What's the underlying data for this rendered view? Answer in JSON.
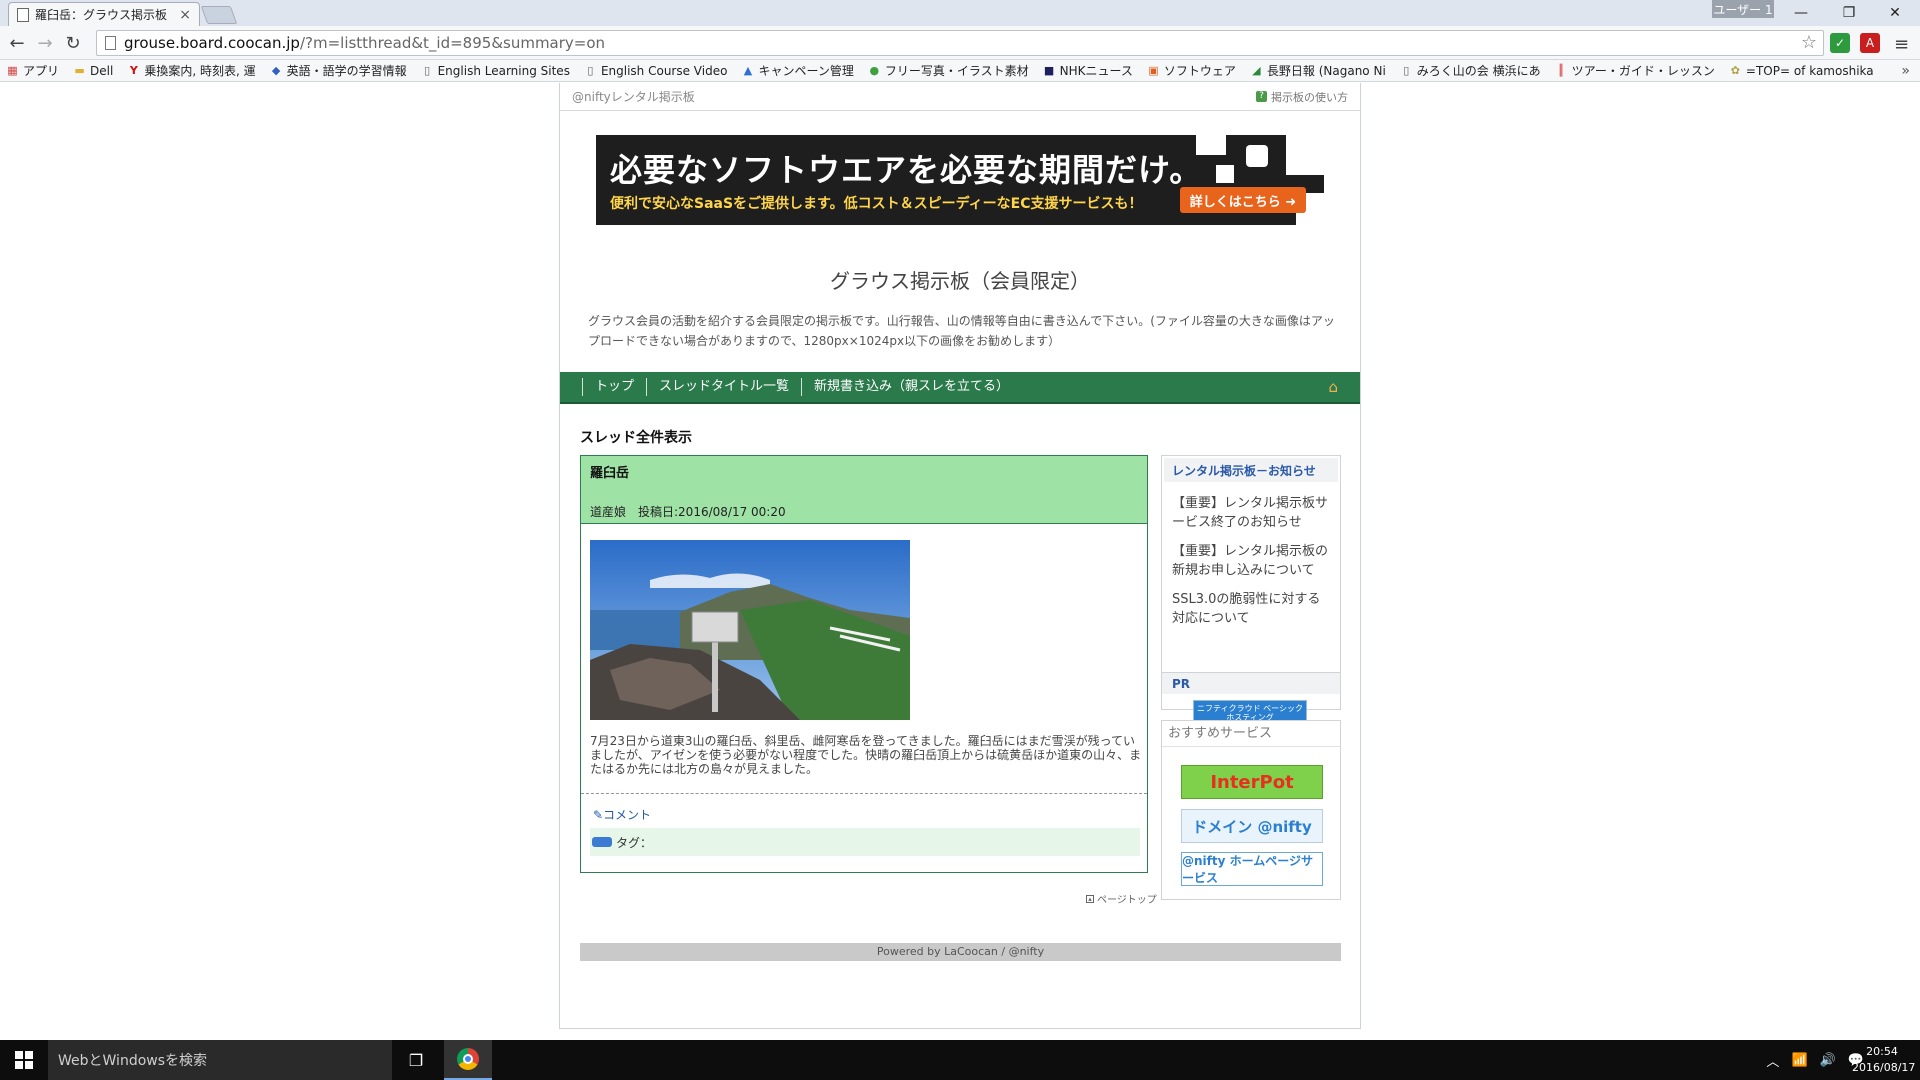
{
  "browser": {
    "tab_title": "羅臼岳：グラウス掲示板（会",
    "tab_close": "×",
    "user_badge": "ユーザー 1",
    "minimize": "—",
    "restore": "❐",
    "close": "✕",
    "back": "←",
    "forward": "→",
    "reload": "↻",
    "url_host": "grouse.board.coocan.jp",
    "url_rest": "/?m=listthread&t_id=895&summary=on",
    "star": "☆",
    "menu": "≡"
  },
  "bookmarks": [
    {
      "label": "アプリ",
      "icon": "apps-icon",
      "glyph": "▦",
      "color": "#d04040"
    },
    {
      "label": "Dell",
      "icon": "folder-icon",
      "glyph": "▬",
      "color": "#e0b030"
    },
    {
      "label": "乗換案内, 時刻表, 運",
      "icon": "yahoo-icon",
      "glyph": "Y",
      "color": "#d01010"
    },
    {
      "label": "英語・語学の学習情報",
      "icon": "link-icon",
      "glyph": "◆",
      "color": "#3060c0"
    },
    {
      "label": "English Learning Sites",
      "icon": "page-icon",
      "glyph": "▯",
      "color": "#666666"
    },
    {
      "label": "English Course Video",
      "icon": "page-icon",
      "glyph": "▯",
      "color": "#666666"
    },
    {
      "label": "キャンペーン管理",
      "icon": "adwords-icon",
      "glyph": "▲",
      "color": "#3070d0"
    },
    {
      "label": "フリー写真・イラスト素材",
      "icon": "globe-icon",
      "glyph": "●",
      "color": "#40a040"
    },
    {
      "label": "NHKニュース",
      "icon": "nhk-icon",
      "glyph": "■",
      "color": "#202060"
    },
    {
      "label": "ソフトウェア",
      "icon": "windows-icon",
      "glyph": "▣",
      "color": "#e06020"
    },
    {
      "label": "長野日報 (Nagano Ni",
      "icon": "nagano-icon",
      "glyph": "◢",
      "color": "#2a8a3a"
    },
    {
      "label": "みろく山の会 横浜にあ",
      "icon": "page-icon",
      "glyph": "▯",
      "color": "#666666"
    },
    {
      "label": "ツアー・ガイド・レッスン",
      "icon": "tour-icon",
      "glyph": "║",
      "color": "#d02020"
    },
    {
      "label": "=TOP= of kamoshika",
      "icon": "kamoshika-icon",
      "glyph": "✿",
      "color": "#b0a040"
    }
  ],
  "bookmarks_more": "»",
  "page": {
    "header_label": "@niftyレンタル掲示板",
    "help_link": "掲示板の使い方",
    "help_glyph": "?",
    "banner": {
      "headline": "必要なソフトウエアを必要な期間だけ。",
      "subline": "便利で安心なSaaSをご提供します。低コスト＆スピーディーなEC支援サービスも！",
      "button": "詳しくはこちら ➜"
    },
    "board_title": "グラウス掲示板（会員限定）",
    "board_description": "グラウス会員の活動を紹介する会員限定の掲示板です。山行報告、山の情報等自由に書き込んで下さい。(ファイル容量の大きな画像はアップロードできない場合がありますので、1280px×1024px以下の画像をお勧めします）",
    "nav": [
      "トップ",
      "スレッドタイトル一覧",
      "新規書き込み（親スレを立てる）"
    ],
    "home_glyph": "⌂",
    "section_title": "スレッド全件表示",
    "post": {
      "title": "羅臼岳",
      "meta": "道産娘　投稿日:2016/08/17 00:20",
      "body": "7月23日から道東3山の羅臼岳、斜里岳、雌阿寒岳を登ってきました。羅臼岳にはまだ雪渓が残っていましたが、アイゼンを使う必要がない程度でした。快晴の羅臼岳頂上からは硫黄岳ほか道東の山々、またはるか先には北方の島々が見えました。",
      "comment_link": "✎コメント",
      "tag_label": "タグ："
    },
    "page_top": "ページトップ",
    "page_top_glyph": "▴",
    "notice": {
      "header": "レンタル掲示板－お知らせ",
      "items": [
        "【重要】レンタル掲示板サービス終了のお知らせ",
        "【重要】レンタル掲示板の新規お申し込みについて",
        "SSL3.0の脆弱性に対する対応について"
      ],
      "pr_label": "PR",
      "pr_banner": "ニフティクラウド ベーシックホスティング"
    },
    "recommend": {
      "header": "おすすめサービス",
      "banners": [
        "InterPot",
        "ドメイン @nifty",
        "@nifty ホームページサービス"
      ]
    },
    "footer": "Powered by LaCoocan / @nifty"
  },
  "taskbar": {
    "search_placeholder": "WebとWindowsを検索",
    "taskview_glyph": "❐",
    "tray_up": "︿",
    "tray_network": "📶",
    "tray_volume": "🔊",
    "tray_message": "💬",
    "time": "20:54",
    "date": "2016/08/17"
  }
}
